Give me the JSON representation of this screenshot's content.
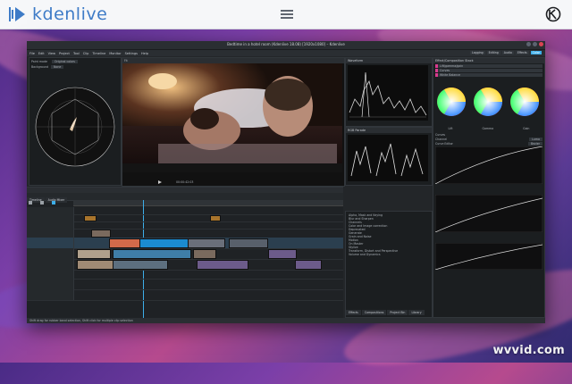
{
  "brand": {
    "name": "kdenlive",
    "accent": "#3e7bc7"
  },
  "window": {
    "title": "Bedtime in a hotel room (Kdenlive 18.08) [1920x1080] – Kdenlive",
    "menu": [
      "File",
      "Edit",
      "View",
      "Project",
      "Tool",
      "Clip",
      "Timeline",
      "Monitor",
      "Settings",
      "Help"
    ],
    "layouts": [
      "Logging",
      "Editing",
      "Audio",
      "Effects",
      "Color"
    ],
    "active_layout": "Color"
  },
  "scopes": {
    "vectorscope_title": "Vectorscope",
    "paint_mode_label": "Paint mode",
    "paint_mode_value": "Original colors",
    "background_label": "Background",
    "background_value": "None",
    "waveform_title": "Waveform",
    "rgb_parade_title": "RGB Parade",
    "histogram_title": "Histogram"
  },
  "monitor": {
    "tab_clip": "Clip Monitor",
    "tab_project": "Project Monitor",
    "timecode": "00:00:42:03"
  },
  "effects": {
    "panel_title": "Effect/Composition Stack",
    "items": [
      "Lift/gamma/gain",
      "Curves",
      "White Balance"
    ],
    "lift": "Lift",
    "gamma": "Gamma",
    "gain": "Gain",
    "curves_label": "Curves",
    "channel_label": "Channel",
    "channel_value": "Luma",
    "mode_label": "Curve Editor",
    "mode_value": "Bezier",
    "bottom_tabs": [
      "Effects",
      "Compositions",
      "Project Bin",
      "Library"
    ]
  },
  "effect_list": [
    "Alpha, Mask and Keying",
    "Blur and Sharpen",
    "Channels",
    "Color and Image correction",
    "Deprecated",
    "Generate",
    "Grain and Noise",
    "Motion",
    "On Master",
    "Stylize",
    "Transform, Distort and Perspective",
    "Volume and Dynamics"
  ],
  "timeline": {
    "tab_timeline": "Timeline",
    "tab_mixer": "Audio Mixer"
  },
  "status": "Shift drag for rubber band selection, Shift click for multiple clip selection",
  "watermark": "wvvid.com"
}
